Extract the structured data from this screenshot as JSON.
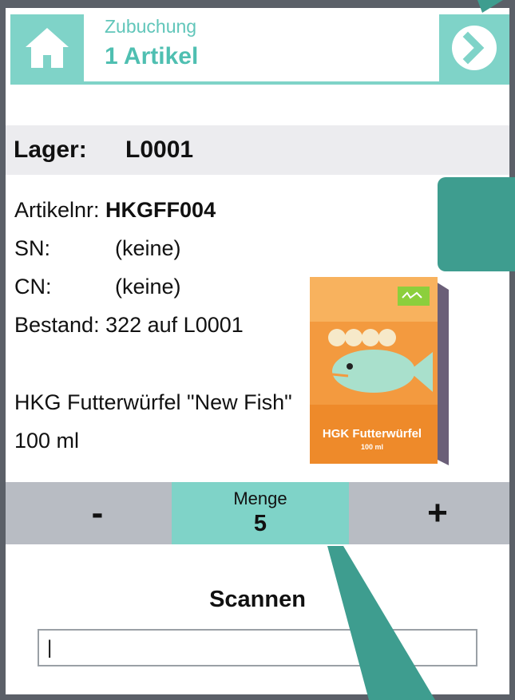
{
  "header": {
    "subtitle": "Zubuchung",
    "title": "1 Artikel",
    "home_icon": "home-icon",
    "next_icon": "chevron-right-circle-icon"
  },
  "lager": {
    "label": "Lager:",
    "value": "L0001"
  },
  "article": {
    "nr_label": "Artikelnr:",
    "nr_value": "HKGFF004",
    "sn_label": "SN:",
    "sn_value": "(keine)",
    "cn_label": "CN:",
    "cn_value": "(keine)",
    "bestand_label": "Bestand:",
    "bestand_value": "322 auf L0001",
    "description": "HKG Futterwürfel \"New Fish\" 100 ml"
  },
  "product_image": {
    "text_main": "HGK Futterwürfel",
    "text_sub": "100 ml"
  },
  "quantity": {
    "minus_label": "-",
    "label": "Menge",
    "value": "5",
    "plus_label": "+"
  },
  "scan": {
    "title": "Scannen",
    "input_value": "|"
  },
  "colors": {
    "accent": "#7fd3c8",
    "accent_dark": "#3e9d8f",
    "band": "#ececef",
    "qty_bar": "#b8bcc3",
    "frame": "#5b6068"
  }
}
